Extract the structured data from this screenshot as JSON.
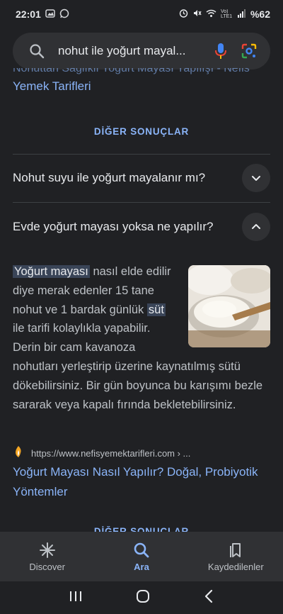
{
  "status_bar": {
    "time": "22:01",
    "network_label": "Vo) LTE1",
    "battery": "%62"
  },
  "search": {
    "query": "nohut ile yoğurt mayal..."
  },
  "previous_result": {
    "cut_text": "Nohuttan Sağlıklı Yoğurt Mayası Yapılışı - Nefis",
    "title": "Yemek Tarifleri"
  },
  "more_results_label": "DİĞER SONUÇLAR",
  "questions": [
    {
      "text": "Nohut suyu ile yoğurt mayalanır mı?",
      "state": "collapsed"
    },
    {
      "text": "Evde yoğurt mayası yoksa ne yapılır?",
      "state": "expanded"
    }
  ],
  "answer": {
    "hl1": "Yoğurt mayası",
    "part1": " nasıl elde edilir diye merak edenler 15 tane nohut ve 1 bardak günlük ",
    "hl2": "süt",
    "part2": " ile tarifi kolaylıkla yapabilir. Derin bir cam kavanoza nohutları yerleştirip üzerine kaynatılmış sütü dökebilirsiniz. Bir gün boyunca bu karışımı bezle sararak veya kapalı fırında bekletebilirsiniz.",
    "source_url": "https://www.nefisyemektarifleri.com › ...",
    "source_title": "Yoğurt Mayası Nasıl Yapılır? Doğal, Probiyotik Yöntemler"
  },
  "more_results_label_2": "DİĞER SONUÇLAR",
  "bottom_nav": [
    {
      "label": "Discover",
      "icon": "asterisk-icon",
      "active": false
    },
    {
      "label": "Ara",
      "icon": "search-icon",
      "active": true
    },
    {
      "label": "Kaydedilenler",
      "icon": "bookmarks-icon",
      "active": false
    }
  ],
  "colors": {
    "background": "#202124",
    "link": "#8ab4f8",
    "surface": "#303134"
  }
}
